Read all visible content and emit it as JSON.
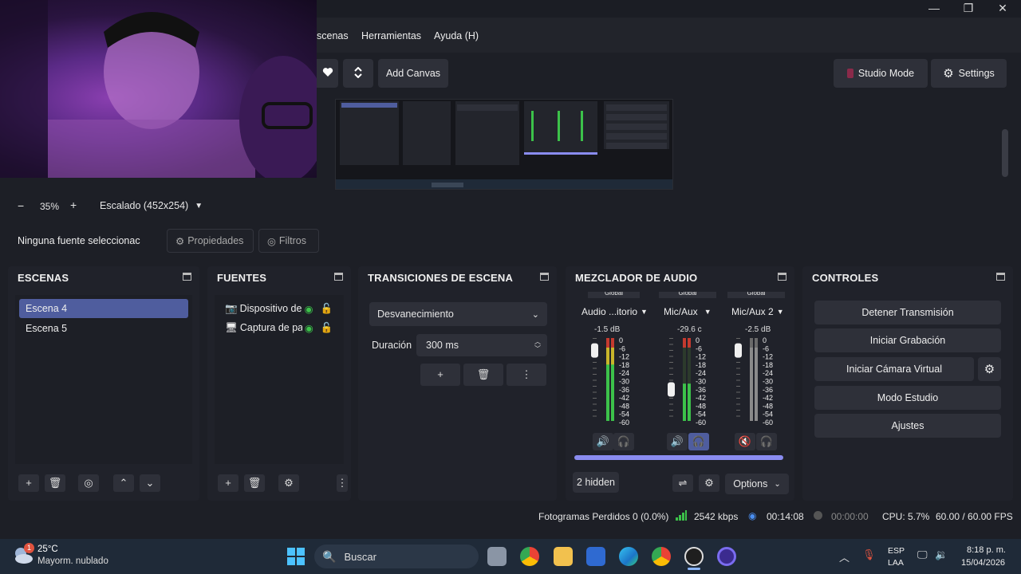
{
  "window": {
    "minimize_glyph": "—",
    "maximize_glyph": "❐",
    "close_glyph": "✕"
  },
  "menu": {
    "scenes": "scenas",
    "tools": "Herramientas",
    "help": "Ayuda (H)"
  },
  "toolbar": {
    "add_canvas": "Add Canvas",
    "studio_mode": "Studio Mode",
    "settings": "Settings"
  },
  "zoom": {
    "minus": "−",
    "value": "35%",
    "plus": "+",
    "scale_mode": "Escalado (452x254)"
  },
  "source_bar": {
    "no_source": "Ninguna fuente seleccionac",
    "properties": "Propiedades",
    "filters": "Filtros"
  },
  "scenes": {
    "title": "ESCENAS",
    "items": [
      "Escena 4",
      "Escena 5"
    ]
  },
  "sources": {
    "title": "FUENTES",
    "items": [
      "Dispositivo de",
      "Captura de pan"
    ]
  },
  "transitions": {
    "title": "TRANSICIONES DE ESCENA",
    "selected": "Desvanecimiento",
    "duration_label": "Duración",
    "duration_value": "300 ms"
  },
  "mixer": {
    "title": "MEZCLADOR DE AUDIO",
    "group_label": "Global",
    "channels": [
      {
        "name": "Audio ...itorio",
        "db": "-1.5 dB",
        "level": 0.92,
        "muted": false
      },
      {
        "name": "Mic/Aux",
        "db": "-29.6 c",
        "level": 0.45,
        "muted": false
      },
      {
        "name": "Mic/Aux 2",
        "db": "-2.5 dB",
        "level": 0.9,
        "muted": true
      }
    ],
    "scale": [
      "0",
      "-6",
      "-12",
      "-18",
      "-24",
      "-30",
      "-36",
      "-42",
      "-48",
      "-54",
      "-60"
    ],
    "hidden": "2 hidden",
    "options": "Options"
  },
  "controls": {
    "title": "CONTROLES",
    "stop_stream": "Detener Transmisión",
    "start_recording": "Iniciar Grabación",
    "start_virtual_cam": "Iniciar Cámara Virtual",
    "studio_mode": "Modo Estudio",
    "settings": "Ajustes"
  },
  "status": {
    "dropped_frames": "Fotogramas Perdidos 0 (0.0%)",
    "bitrate": "2542 kbps",
    "stream_time": "00:14:08",
    "rec_time": "00:00:00",
    "cpu": "CPU: 5.7%",
    "fps": "60.00 / 60.00 FPS"
  },
  "taskbar": {
    "weather_temp": "25°C",
    "weather_desc": "Mayorm. nublado",
    "weather_badge": "1",
    "search": "Buscar",
    "lang_top": "ESP",
    "lang_bottom": "LAA",
    "time": "8:18 p. m.",
    "date": "15/04/2026"
  },
  "colors": {
    "accent": "#4f5d9e",
    "meter_green": "#3cc24a",
    "meter_yellow": "#c8b52a",
    "meter_red": "#c43a2f",
    "mute_red": "#d9534f"
  }
}
